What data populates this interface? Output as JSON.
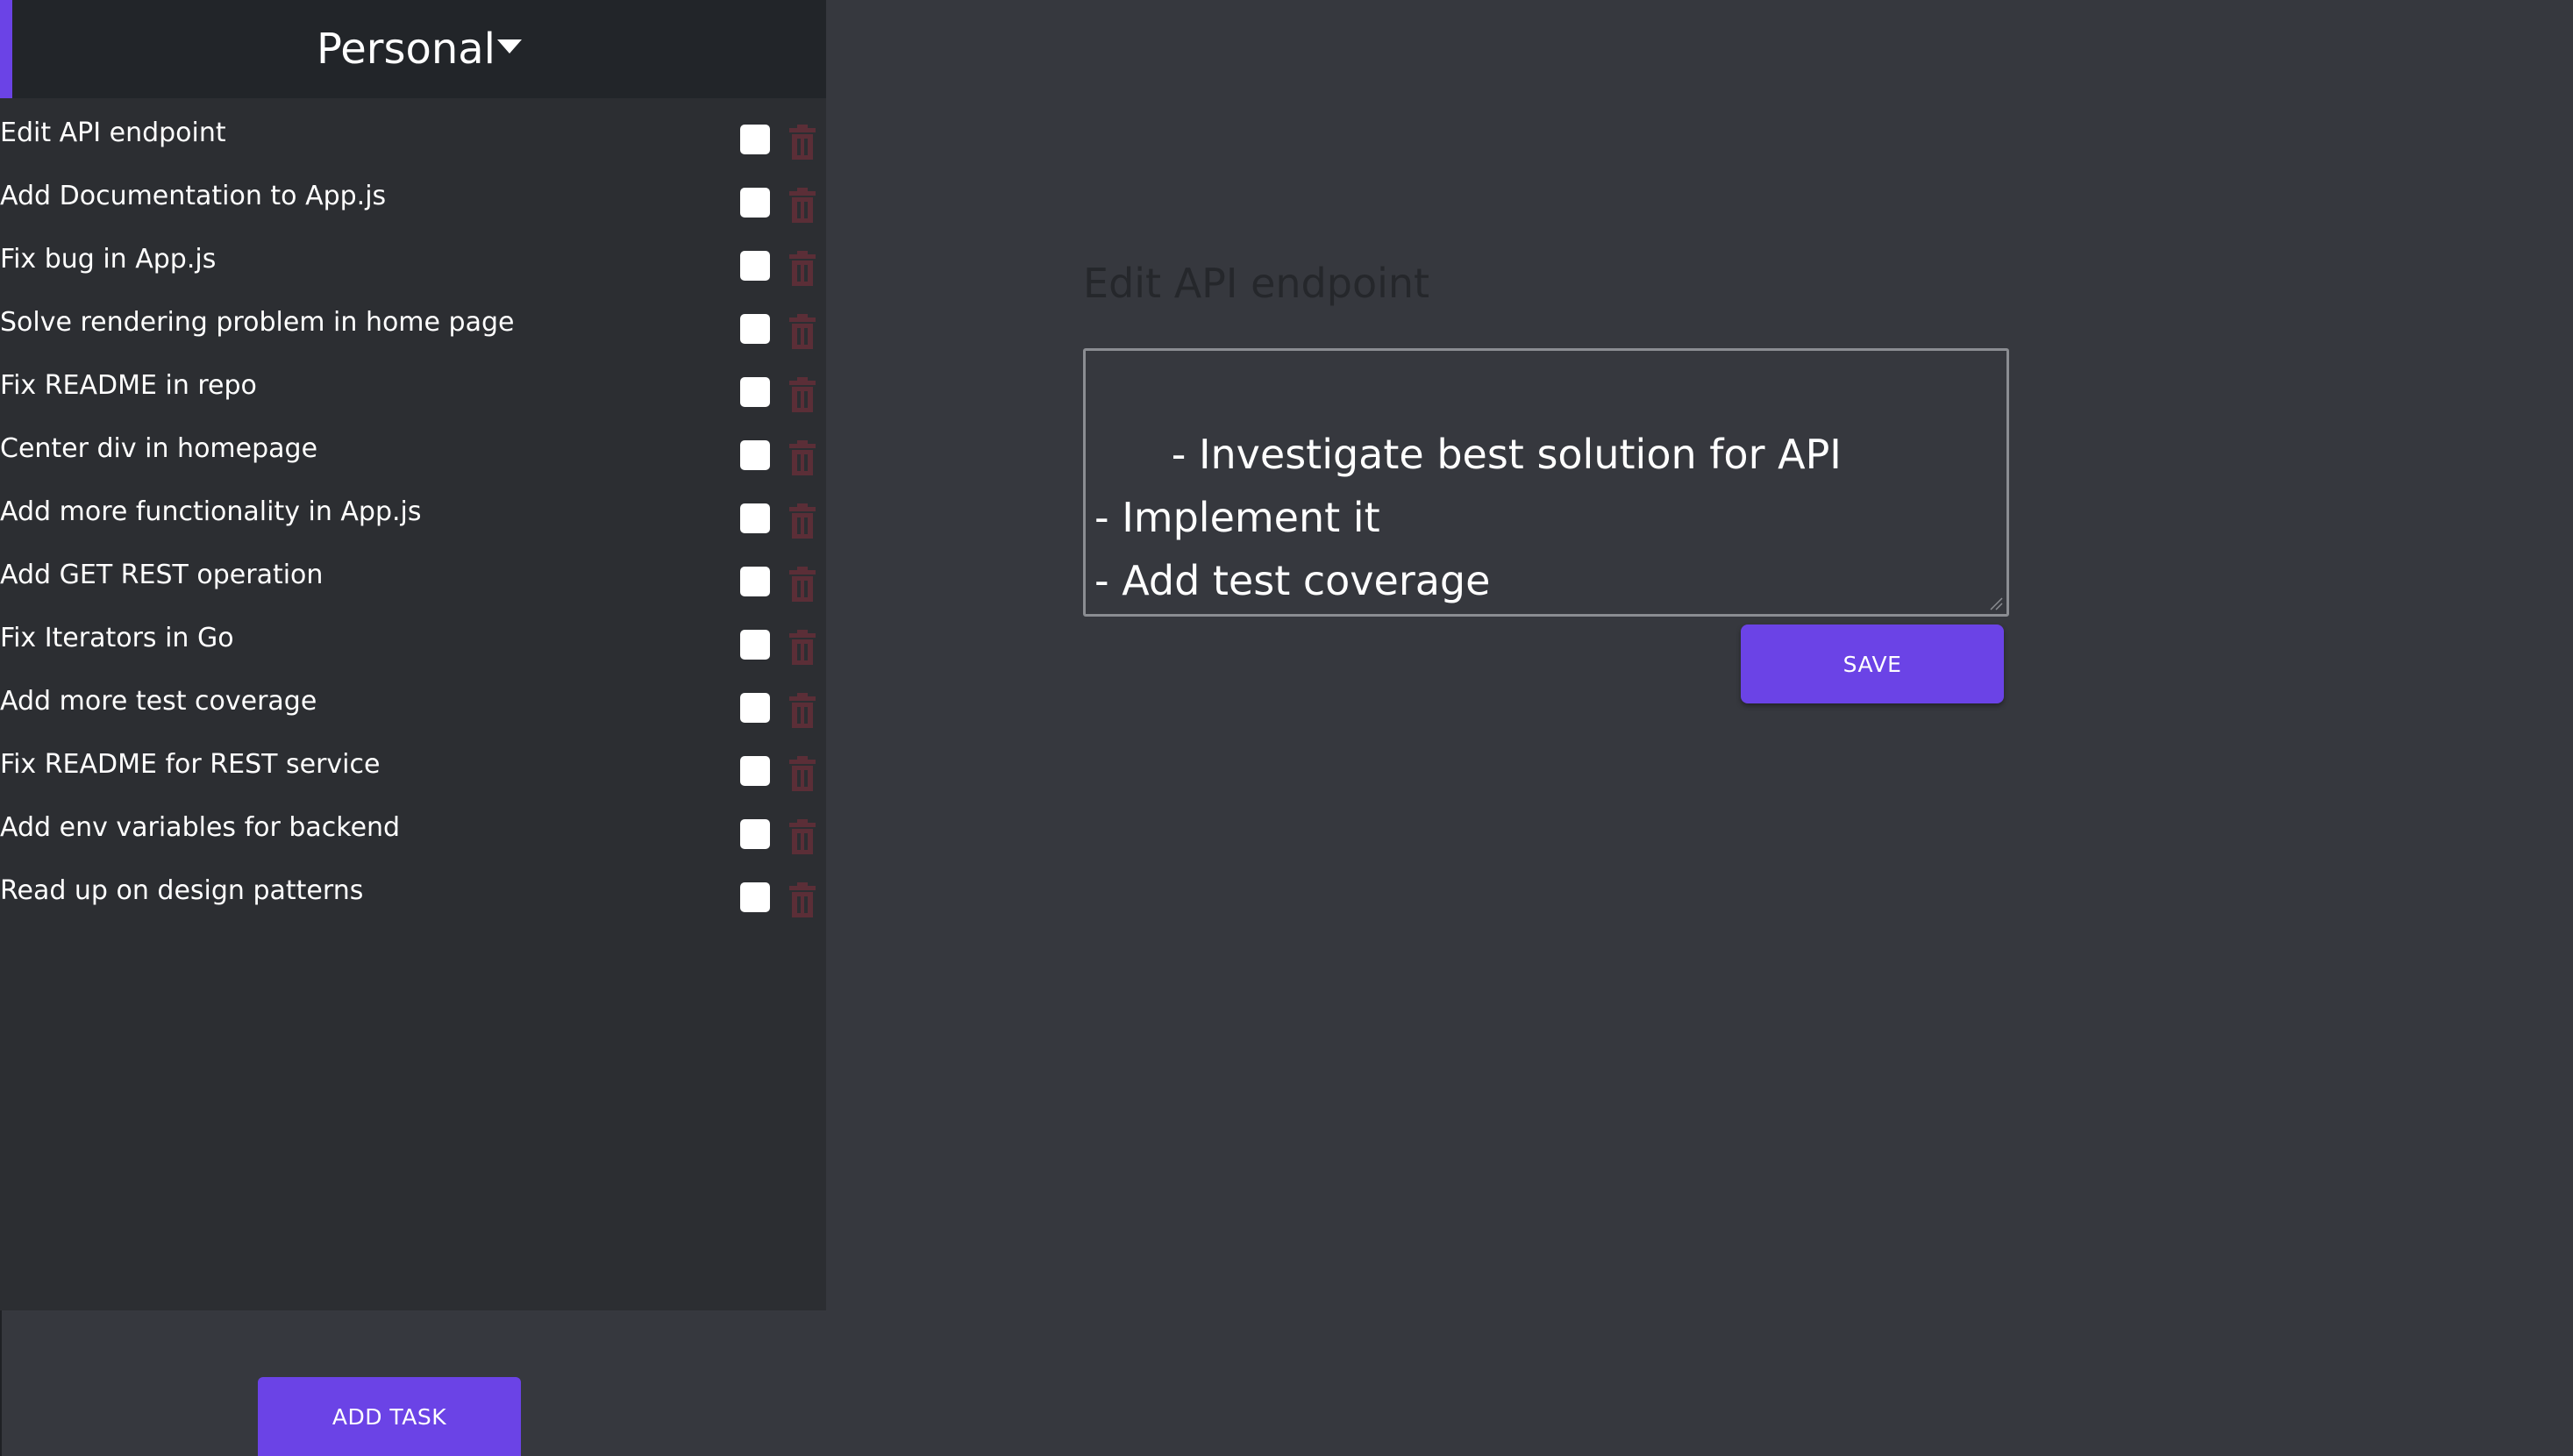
{
  "sidebar": {
    "category": "Personal",
    "tasks": [
      {
        "title": "Edit API endpoint"
      },
      {
        "title": "Add Documentation to App.js"
      },
      {
        "title": "Fix bug in App.js"
      },
      {
        "title": "Solve rendering problem in home page"
      },
      {
        "title": "Fix README in repo"
      },
      {
        "title": "Center div in homepage"
      },
      {
        "title": "Add more functionality in App.js"
      },
      {
        "title": "Add GET REST operation"
      },
      {
        "title": "Fix Iterators in Go"
      },
      {
        "title": "Add more test coverage"
      },
      {
        "title": "Fix README for REST service"
      },
      {
        "title": "Add env variables for backend"
      },
      {
        "title": "Read up on design patterns"
      }
    ],
    "add_task_label": "ADD TASK"
  },
  "editor": {
    "title": "Edit API endpoint",
    "body": "- Investigate best solution for API\n- Implement it\n- Add test coverage",
    "save_label": "SAVE"
  },
  "colors": {
    "accent": "#6b43e6",
    "trash": "#5b2e37",
    "background": "#36383e",
    "sidebar": "#2c2e32",
    "header": "#222529"
  },
  "icons": {
    "dropdown": "caret-down-icon",
    "delete": "trash-icon"
  }
}
